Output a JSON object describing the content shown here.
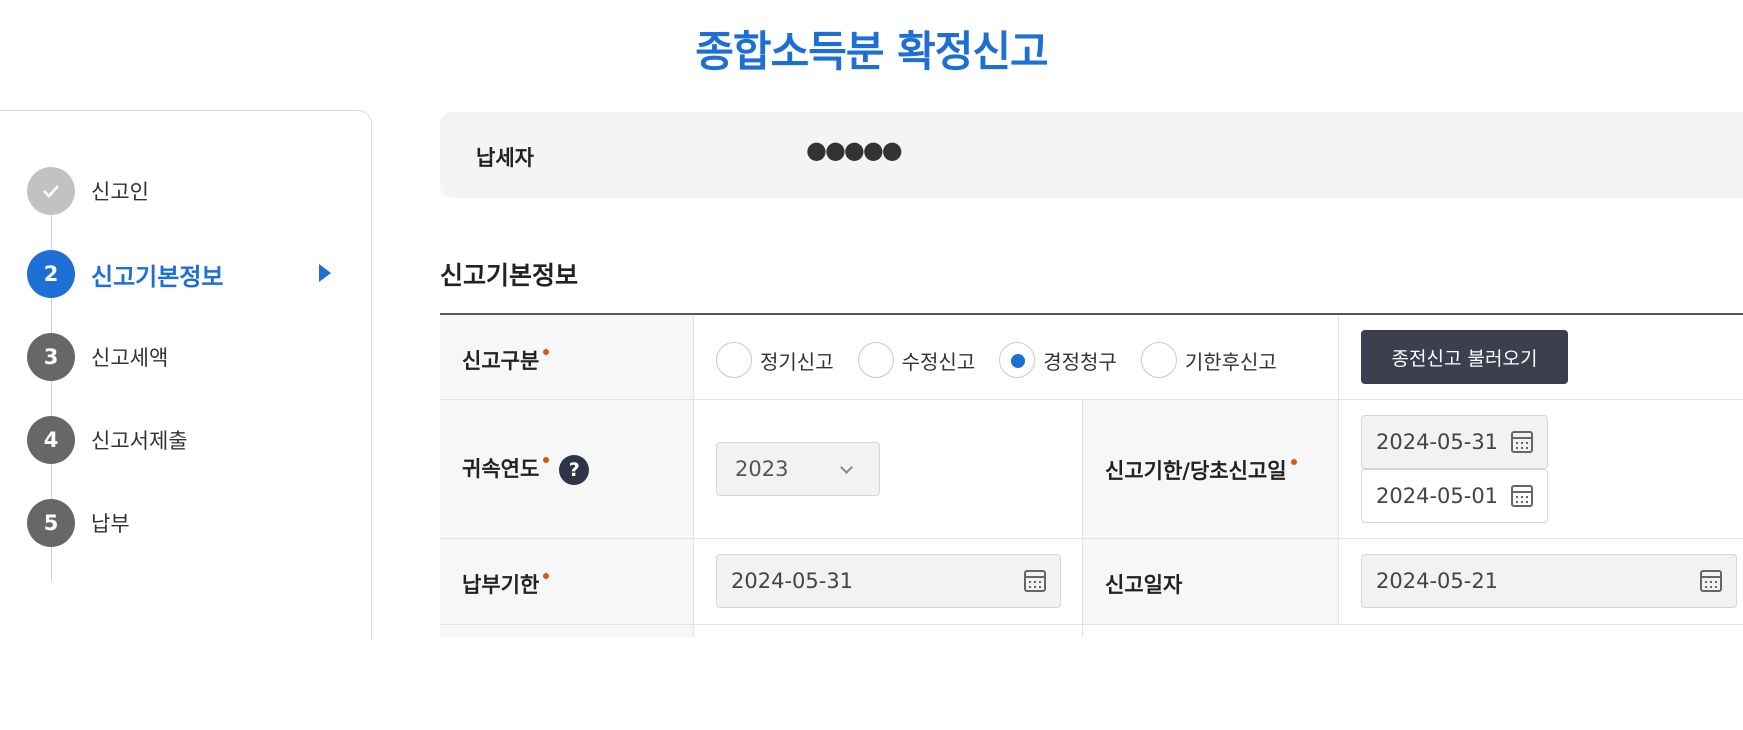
{
  "page": {
    "title": "종합소득분 확정신고"
  },
  "steps": [
    {
      "num": "",
      "label": "신고인",
      "state": "done"
    },
    {
      "num": "2",
      "label": "신고기본정보",
      "state": "active"
    },
    {
      "num": "3",
      "label": "신고세액",
      "state": "todo"
    },
    {
      "num": "4",
      "label": "신고서제출",
      "state": "todo"
    },
    {
      "num": "5",
      "label": "납부",
      "state": "todo"
    }
  ],
  "taxpayer": {
    "label": "납세자",
    "value": "●●●●●"
  },
  "section": {
    "title": "신고기본정보"
  },
  "form": {
    "report_type": {
      "label": "신고구분",
      "options": [
        "정기신고",
        "수정신고",
        "경정청구",
        "기한후신고"
      ],
      "selected": "경정청구",
      "load_button": "종전신고 불러오기"
    },
    "tax_year": {
      "label": "귀속연도",
      "value": "2023",
      "help_icon": "question-icon"
    },
    "report_deadline": {
      "label": "신고기한/당초신고일",
      "deadline": "2024-05-31",
      "original_date": "2024-05-01"
    },
    "payment_deadline": {
      "label": "납부기한",
      "value": "2024-05-31"
    },
    "report_date": {
      "label": "신고일자",
      "value": "2024-05-21"
    }
  },
  "colors": {
    "accent": "#1d6fd6",
    "required": "#e2540a",
    "button_dark": "#3b3f4f"
  }
}
